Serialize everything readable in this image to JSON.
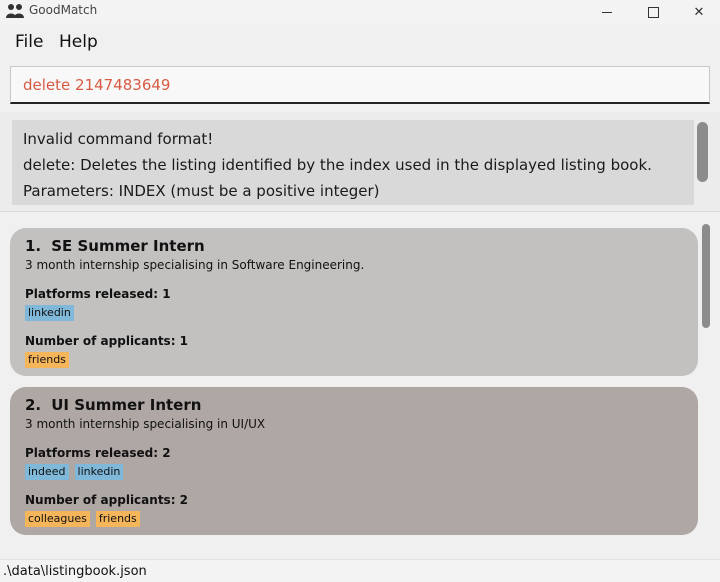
{
  "window": {
    "title": "GoodMatch",
    "icon": "two-people-icon",
    "min_icon": "minimize-icon",
    "max_icon": "maximize-icon",
    "close_icon": "close-icon",
    "close_glyph": "✕"
  },
  "menu": {
    "items": [
      {
        "label": "File"
      },
      {
        "label": "Help"
      }
    ]
  },
  "command_box": {
    "value": "delete 2147483649",
    "text_color": "#d85a43"
  },
  "result": {
    "lines": [
      "Invalid command format!",
      "delete: Deletes the listing identified by the index used in the displayed listing book.",
      "Parameters: INDEX (must be a positive integer)"
    ]
  },
  "listings": [
    {
      "index": "1.",
      "title": "SE Summer Intern",
      "description": "3 month internship specialising in Software Engineering.",
      "platforms_label": "Platforms released: 1",
      "platforms": [
        "linkedin"
      ],
      "applicants_label": "Number of applicants: 1",
      "applicants": [
        "friends"
      ],
      "bg_color": "#c3c1c0"
    },
    {
      "index": "2.",
      "title": "UI Summer Intern",
      "description": "3 month internship specialising in UI/UX",
      "platforms_label": "Platforms released: 2",
      "platforms": [
        "indeed",
        "linkedin"
      ],
      "applicants_label": "Number of applicants: 2",
      "applicants": [
        "colleagues",
        "friends"
      ],
      "bg_color": "#aea7a4"
    }
  ],
  "tag_colors": {
    "platform": "#7fb8d8",
    "applicant": "#f5b55a"
  },
  "status_bar": {
    "path": ".\\data\\listingbook.json"
  }
}
